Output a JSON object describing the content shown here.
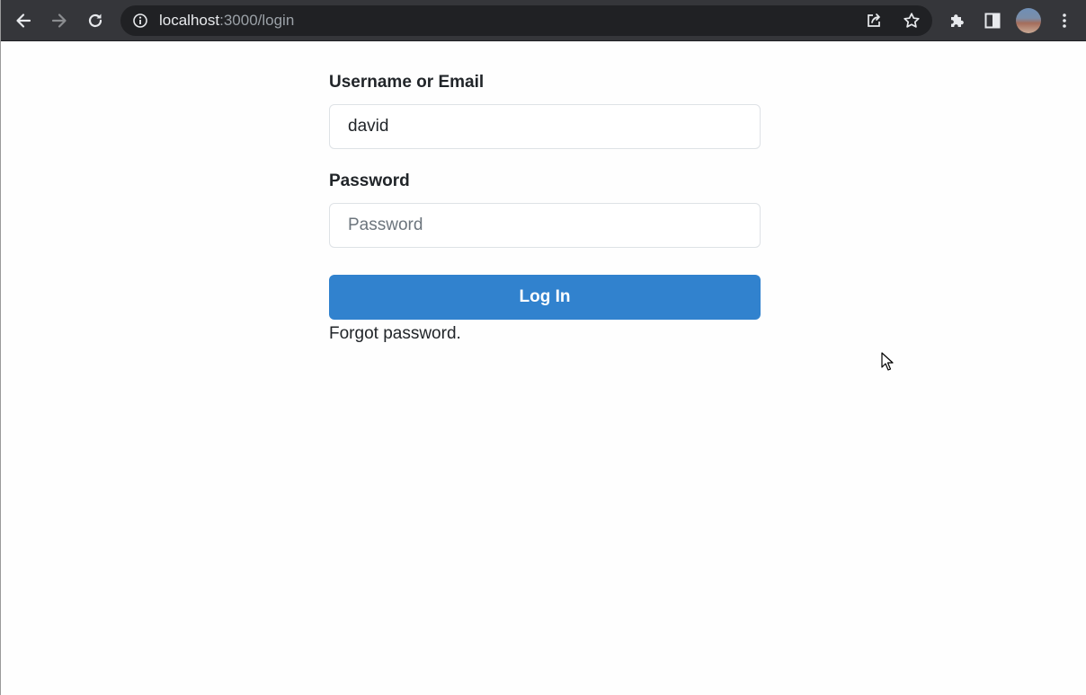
{
  "browser": {
    "url_host": "localhost",
    "url_rest": ":3000/login",
    "icons": {
      "back": "arrow-left-icon",
      "forward": "arrow-right-icon",
      "reload": "reload-icon",
      "site_info": "info-circle-icon",
      "share": "share-icon",
      "bookmark": "star-icon",
      "extensions": "puzzle-icon",
      "side_panel": "side-panel-icon",
      "profile": "avatar",
      "menu": "kebab-menu-icon"
    }
  },
  "form": {
    "username_label": "Username or Email",
    "username_value": "david",
    "password_label": "Password",
    "password_placeholder": "Password",
    "password_value": "",
    "login_button_label": "Log In",
    "forgot_link": "Forgot password."
  },
  "colors": {
    "toolbar_bg": "#35363a",
    "omnibox_bg": "#202124",
    "primary_button": "#3182ce",
    "text": "#212529",
    "input_border": "#dee2e6"
  }
}
